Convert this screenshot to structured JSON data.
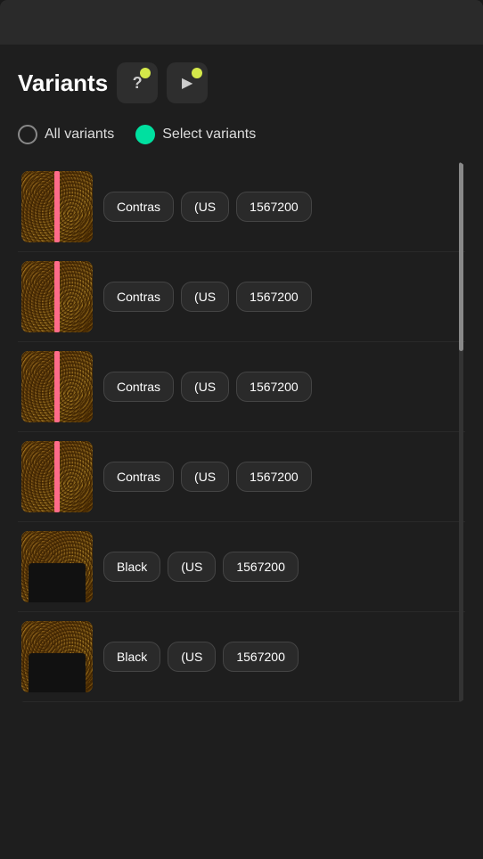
{
  "header": {
    "title": "Variants",
    "help_btn_label": "?",
    "play_btn_label": "▶"
  },
  "radio_options": [
    {
      "id": "all",
      "label": "All variants",
      "active": false
    },
    {
      "id": "select",
      "label": "Select variants",
      "active": true
    }
  ],
  "variants": [
    {
      "id": 1,
      "image_type": "leopard-pink",
      "tags": [
        "Contras",
        "(US",
        "1567200"
      ]
    },
    {
      "id": 2,
      "image_type": "leopard-pink",
      "tags": [
        "Contras",
        "(US",
        "1567200"
      ]
    },
    {
      "id": 3,
      "image_type": "leopard-pink",
      "tags": [
        "Contras",
        "(US",
        "1567200"
      ]
    },
    {
      "id": 4,
      "image_type": "leopard-pink",
      "tags": [
        "Contras",
        "(US",
        "1567200"
      ]
    },
    {
      "id": 5,
      "image_type": "black",
      "tags": [
        "Black",
        "(US",
        "1567200"
      ]
    },
    {
      "id": 6,
      "image_type": "black",
      "tags": [
        "Black",
        "(US",
        "1567200"
      ]
    }
  ]
}
